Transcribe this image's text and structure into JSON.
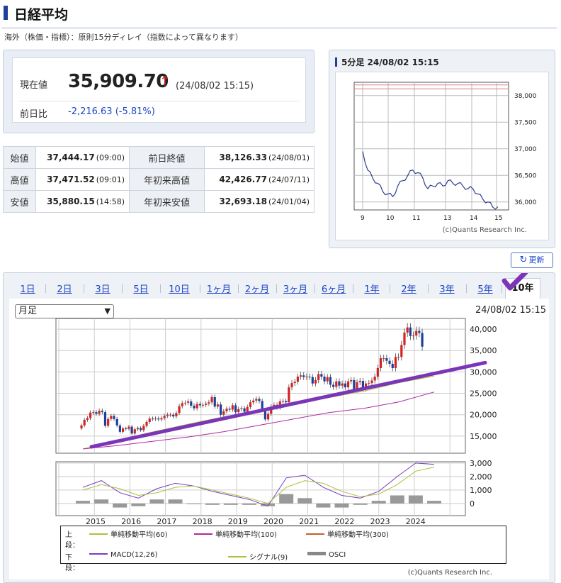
{
  "header": {
    "title": "日経平均",
    "note": "海外（株価・指標）：原則15分ディレイ（指数によって異なります）"
  },
  "quote": {
    "price_label": "現在値",
    "price": "35,909.70",
    "arrow": "↑",
    "time": "(24/08/02 15:15)",
    "change_label": "前日比",
    "change": "-2,216.63 (-5.81%)"
  },
  "ohlc": [
    {
      "label": "始値",
      "value": "37,444.17",
      "time": "(09:00)",
      "label2": "前日終値",
      "value2": "38,126.33",
      "time2": "(24/08/01)"
    },
    {
      "label": "高値",
      "value": "37,471.52",
      "time": "(09:01)",
      "label2": "年初来高値",
      "value2": "42,426.77",
      "time2": "(24/07/11)"
    },
    {
      "label": "安値",
      "value": "35,880.15",
      "time": "(14:58)",
      "label2": "年初来安値",
      "value2": "32,693.18",
      "time2": "(24/01/04)"
    }
  ],
  "mini_chart": {
    "title": "5分足 24/08/02 15:15",
    "credit": "(c)Quants Research Inc.",
    "x_ticks": [
      "9",
      "10",
      "11",
      "13",
      "14",
      "15"
    ],
    "y_ticks": [
      "38,000",
      "37,500",
      "37,000",
      "36,500",
      "36,000"
    ],
    "ref_line_colors": [
      "#d98080",
      "#d98080"
    ]
  },
  "refresh": {
    "label": "更新",
    "icon": "refresh-icon"
  },
  "tabs": [
    "1日",
    "2日",
    "3日",
    "5日",
    "10日",
    "1ヶ月",
    "2ヶ月",
    "3ヶ月",
    "6ヶ月",
    "1年",
    "2年",
    "3年",
    "5年",
    "10年"
  ],
  "active_tab": "10年",
  "period_select": {
    "value": "月足",
    "options": [
      "月足"
    ]
  },
  "main_timestamp": "24/08/02 15:15",
  "legend": {
    "upper_head": "上段：",
    "lower_head": "下段：",
    "upper": [
      {
        "label": "単純移動平均(60)",
        "color": "#a8c43c"
      },
      {
        "label": "単純移動平均(100)",
        "color": "#b02a9c"
      },
      {
        "label": "単純移動平均(300)",
        "color": "#c0602a"
      }
    ],
    "lower": [
      {
        "label": "MACD(12,26)",
        "color": "#7b3cc0"
      },
      {
        "label": "シグナル(9)",
        "color": "#a8c43c"
      },
      {
        "label": "OSCI",
        "color": "#888888"
      }
    ]
  },
  "main_credit": "(c)Quants Research Inc.",
  "chart_data": [
    {
      "type": "line",
      "title": "5分足 24/08/02 15:15",
      "x": [
        "9:00",
        "9:10",
        "9:20",
        "9:30",
        "9:40",
        "9:50",
        "10:00",
        "10:10",
        "10:20",
        "10:30",
        "10:40",
        "10:50",
        "11:00",
        "11:10",
        "11:20",
        "11:30",
        "12:30",
        "12:45",
        "13:00",
        "13:15",
        "13:30",
        "13:45",
        "14:00",
        "14:15",
        "14:30",
        "14:45",
        "15:00",
        "15:15"
      ],
      "series": [
        {
          "values": [
            36950,
            36600,
            36450,
            36350,
            36200,
            36150,
            36100,
            36300,
            36400,
            36500,
            36600,
            36550,
            36450,
            36250,
            36300,
            36350,
            36300,
            36400,
            36350,
            36350,
            36300,
            36250,
            36250,
            36150,
            36050,
            36000,
            35900,
            35910
          ]
        }
      ],
      "x_ticks": [
        "9",
        "10",
        "11",
        "13",
        "14",
        "15"
      ],
      "ylim": [
        35850,
        38250
      ],
      "y_ticks": [
        36000,
        36500,
        37000,
        37500,
        38000
      ],
      "reference_lines": [
        38126.33,
        38200
      ],
      "grid": true
    },
    {
      "type": "candlestick",
      "title": "",
      "x_ticks": [
        "2015",
        "2016",
        "2017",
        "2018",
        "2019",
        "2020",
        "2021",
        "2022",
        "2023",
        "2024"
      ],
      "y_ticks": [
        15000,
        20000,
        25000,
        30000,
        35000,
        40000
      ],
      "ylim": [
        11000,
        42500
      ],
      "candles_yearly_close": [
        {
          "year": "2015",
          "values": [
            17500,
            18800,
            19200,
            20500,
            20600,
            20200,
            20900,
            20600,
            17400,
            19000,
            19700,
            19000
          ]
        },
        {
          "year": "2016",
          "values": [
            17500,
            16000,
            16800,
            16700,
            17200,
            15600,
            16600,
            16900,
            16400,
            17400,
            18300,
            19100
          ]
        },
        {
          "year": "2017",
          "values": [
            19000,
            19100,
            18900,
            19200,
            19700,
            20000,
            20000,
            19600,
            20400,
            22000,
            22700,
            22800
          ]
        },
        {
          "year": "2018",
          "values": [
            23100,
            22100,
            21500,
            22500,
            22200,
            22300,
            22600,
            22900,
            24100,
            21900,
            22400,
            20000
          ]
        },
        {
          "year": "2019",
          "values": [
            20800,
            21400,
            21200,
            22200,
            20600,
            21300,
            21500,
            20700,
            21800,
            22900,
            23300,
            23700
          ]
        },
        {
          "year": "2020",
          "values": [
            23200,
            21100,
            18900,
            20200,
            21900,
            22300,
            21700,
            23100,
            23200,
            22900,
            26400,
            27400
          ]
        },
        {
          "year": "2021",
          "values": [
            27700,
            28900,
            29200,
            28800,
            28900,
            28800,
            27300,
            28100,
            29500,
            28900,
            27800,
            28800
          ]
        },
        {
          "year": "2022",
          "values": [
            27000,
            26500,
            27800,
            26800,
            27300,
            26400,
            27800,
            28100,
            26000,
            27600,
            27900,
            26100
          ]
        },
        {
          "year": "2023",
          "values": [
            27300,
            27400,
            28000,
            28900,
            30900,
            33200,
            33200,
            32600,
            31900,
            30900,
            33500,
            33500
          ]
        },
        {
          "year": "2024",
          "values": [
            36300,
            39200,
            40400,
            38400,
            38500,
            39600,
            39100,
            35910
          ]
        }
      ],
      "series": [
        {
          "name": "単純移動平均(60)",
          "values": [
            12000,
            14000,
            16000,
            17800,
            19500,
            21000,
            22500,
            24000,
            25500,
            27500,
            29000
          ]
        },
        {
          "name": "単純移動平均(100)",
          "values": [
            12000,
            12800,
            13800,
            14800,
            16000,
            17500,
            19000,
            20500,
            21500,
            23000,
            25300
          ]
        },
        {
          "name": "単純移動平均(300)",
          "values": []
        }
      ],
      "trend_line": [
        [
          2015.0,
          13000
        ],
        [
          2024.8,
          31500
        ]
      ],
      "grid": true
    },
    {
      "type": "line",
      "title": "",
      "x_ticks": [
        "2015",
        "2016",
        "2017",
        "2018",
        "2019",
        "2020",
        "2021",
        "2022",
        "2023",
        "2024"
      ],
      "y_ticks": [
        0,
        1000,
        2000,
        3000
      ],
      "ylim": [
        -900,
        3100
      ],
      "series": [
        {
          "name": "MACD(12,26)",
          "values": [
            1200,
            1700,
            800,
            400,
            1100,
            1500,
            1300,
            900,
            600,
            300,
            -200,
            1900,
            2100,
            1200,
            600,
            400,
            900,
            2000,
            3000,
            2900
          ]
        },
        {
          "name": "シグナル(9)",
          "values": [
            1000,
            1400,
            1100,
            600,
            800,
            1200,
            1300,
            1000,
            700,
            400,
            0,
            1200,
            1700,
            1500,
            900,
            500,
            700,
            1400,
            2400,
            2700
          ]
        },
        {
          "name": "OSCI",
          "values": [
            200,
            300,
            -300,
            -200,
            300,
            300,
            0,
            -100,
            -100,
            -100,
            -200,
            700,
            400,
            -300,
            -300,
            -100,
            200,
            600,
            600,
            200
          ]
        }
      ],
      "grid": true
    }
  ]
}
